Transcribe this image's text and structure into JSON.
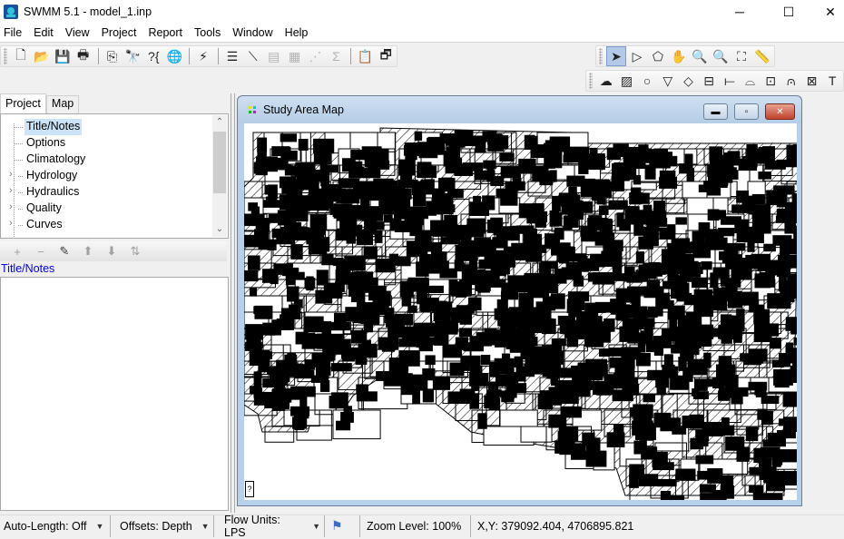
{
  "window": {
    "title": "SWMM 5.1 - model_1.inp",
    "controls": [
      "minimize",
      "maximize",
      "close"
    ]
  },
  "menu": [
    "File",
    "Edit",
    "View",
    "Project",
    "Report",
    "Tools",
    "Window",
    "Help"
  ],
  "toolbar_standard": [
    {
      "icon": "new-file-icon",
      "glyph": "🗋"
    },
    {
      "icon": "open-folder-icon",
      "glyph": "📂"
    },
    {
      "icon": "save-icon",
      "glyph": "💾"
    },
    {
      "icon": "print-icon",
      "glyph": "🖶"
    },
    {
      "icon": "copy-icon",
      "glyph": "⎘"
    },
    {
      "icon": "find-icon",
      "glyph": "🔭"
    },
    {
      "icon": "query-icon",
      "glyph": "?{"
    },
    {
      "icon": "overview-map-icon",
      "glyph": "🌐"
    },
    {
      "icon": "run-simulation-icon",
      "glyph": "⚡"
    },
    {
      "icon": "report-icon",
      "glyph": "☰"
    },
    {
      "icon": "profile-plot-icon",
      "glyph": "⟍"
    },
    {
      "icon": "time-series-plot-icon",
      "glyph": "▤",
      "disabled": true
    },
    {
      "icon": "table-icon",
      "glyph": "▦",
      "disabled": true
    },
    {
      "icon": "scatter-plot-icon",
      "glyph": "⋰",
      "disabled": true
    },
    {
      "icon": "statistics-icon",
      "glyph": "Σ",
      "disabled": true
    },
    {
      "icon": "options-icon",
      "glyph": "📋"
    },
    {
      "icon": "arrange-windows-icon",
      "glyph": "🗗"
    }
  ],
  "toolbar_map": [
    {
      "icon": "select-object-icon",
      "glyph": "➤",
      "active": true
    },
    {
      "icon": "select-vertex-icon",
      "glyph": "▷"
    },
    {
      "icon": "select-region-icon",
      "glyph": "⬠"
    },
    {
      "icon": "pan-icon",
      "glyph": "✋"
    },
    {
      "icon": "zoom-in-icon",
      "glyph": "🔍"
    },
    {
      "icon": "zoom-out-icon",
      "glyph": "🔍",
      "disabled": true
    },
    {
      "icon": "full-extent-icon",
      "glyph": "⛶"
    },
    {
      "icon": "measure-icon",
      "glyph": "📏"
    }
  ],
  "toolbar_objects": [
    {
      "icon": "rain-gage-icon",
      "glyph": "☁"
    },
    {
      "icon": "subcatchment-icon",
      "glyph": "▨"
    },
    {
      "icon": "junction-icon",
      "glyph": "○"
    },
    {
      "icon": "outfall-icon",
      "glyph": "▽"
    },
    {
      "icon": "divider-icon",
      "glyph": "◇"
    },
    {
      "icon": "storage-unit-icon",
      "glyph": "⊟"
    },
    {
      "icon": "conduit-icon",
      "glyph": "⟝"
    },
    {
      "icon": "pump-icon",
      "glyph": "⌓"
    },
    {
      "icon": "orifice-icon",
      "glyph": "⊡"
    },
    {
      "icon": "weir-icon",
      "glyph": "⩀"
    },
    {
      "icon": "outlet-icon",
      "glyph": "⊠"
    },
    {
      "icon": "label-icon",
      "glyph": "T"
    }
  ],
  "left_panel": {
    "tabs": [
      {
        "label": "Project",
        "active": true
      },
      {
        "label": "Map",
        "active": false
      }
    ],
    "tree": [
      {
        "label": "Title/Notes",
        "expandable": false,
        "selected": true
      },
      {
        "label": "Options",
        "expandable": false
      },
      {
        "label": "Climatology",
        "expandable": false
      },
      {
        "label": "Hydrology",
        "expandable": true
      },
      {
        "label": "Hydraulics",
        "expandable": true
      },
      {
        "label": "Quality",
        "expandable": true
      },
      {
        "label": "Curves",
        "expandable": true
      }
    ],
    "edit_toolbar": [
      {
        "icon": "add-icon",
        "glyph": "+"
      },
      {
        "icon": "delete-icon",
        "glyph": "−"
      },
      {
        "icon": "edit-icon",
        "glyph": "✎",
        "enabled": true
      },
      {
        "icon": "move-up-icon",
        "glyph": "⬆"
      },
      {
        "icon": "move-down-icon",
        "glyph": "⬇"
      },
      {
        "icon": "sort-icon",
        "glyph": "⇅"
      }
    ],
    "selected_category": "Title/Notes",
    "notes_text": ""
  },
  "map_window": {
    "title": "Study Area Map",
    "legend_toggle": "?"
  },
  "statusbar": {
    "auto_length": "Auto-Length: Off",
    "offsets": "Offsets: Depth",
    "flow_units": "Flow Units: LPS",
    "zoom_level": "Zoom Level: 100%",
    "coordinates": "X,Y: 379092.404, 4706895.821"
  }
}
